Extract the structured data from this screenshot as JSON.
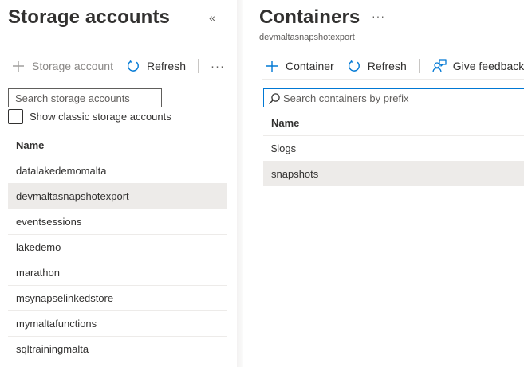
{
  "storage_pane": {
    "title": "Storage accounts",
    "collapse_glyph": "«",
    "toolbar": {
      "add_label": "Storage account",
      "refresh_label": "Refresh",
      "more_glyph": "···"
    },
    "search_placeholder": "Search storage accounts",
    "classic_checkbox_label": "Show classic storage accounts",
    "column_header": "Name",
    "accounts": [
      "datalakedemomalta",
      "devmaltasnapshotexport",
      "eventsessions",
      "lakedemo",
      "marathon",
      "msynapselinkedstore",
      "mymaltafunctions",
      "sqltrainingmalta"
    ],
    "selected_account": "devmaltasnapshotexport"
  },
  "containers_pane": {
    "title": "Containers",
    "more_glyph": "···",
    "subtitle": "devmaltasnapshotexport",
    "toolbar": {
      "add_label": "Container",
      "refresh_label": "Refresh",
      "feedback_label": "Give feedback"
    },
    "search_placeholder": "Search containers by prefix",
    "column_header": "Name",
    "containers": [
      "$logs",
      "snapshots"
    ],
    "selected_container": "snapshots"
  },
  "icons": {
    "add": "plus-icon",
    "refresh": "refresh-icon",
    "feedback": "feedback-icon",
    "search": "search-icon",
    "more": "more-icon",
    "collapse": "double-chevron-left-icon"
  },
  "colors": {
    "accent": "#0078d4",
    "selected_row": "#edebe9",
    "text": "#323130",
    "subtle_text": "#605e5c"
  }
}
